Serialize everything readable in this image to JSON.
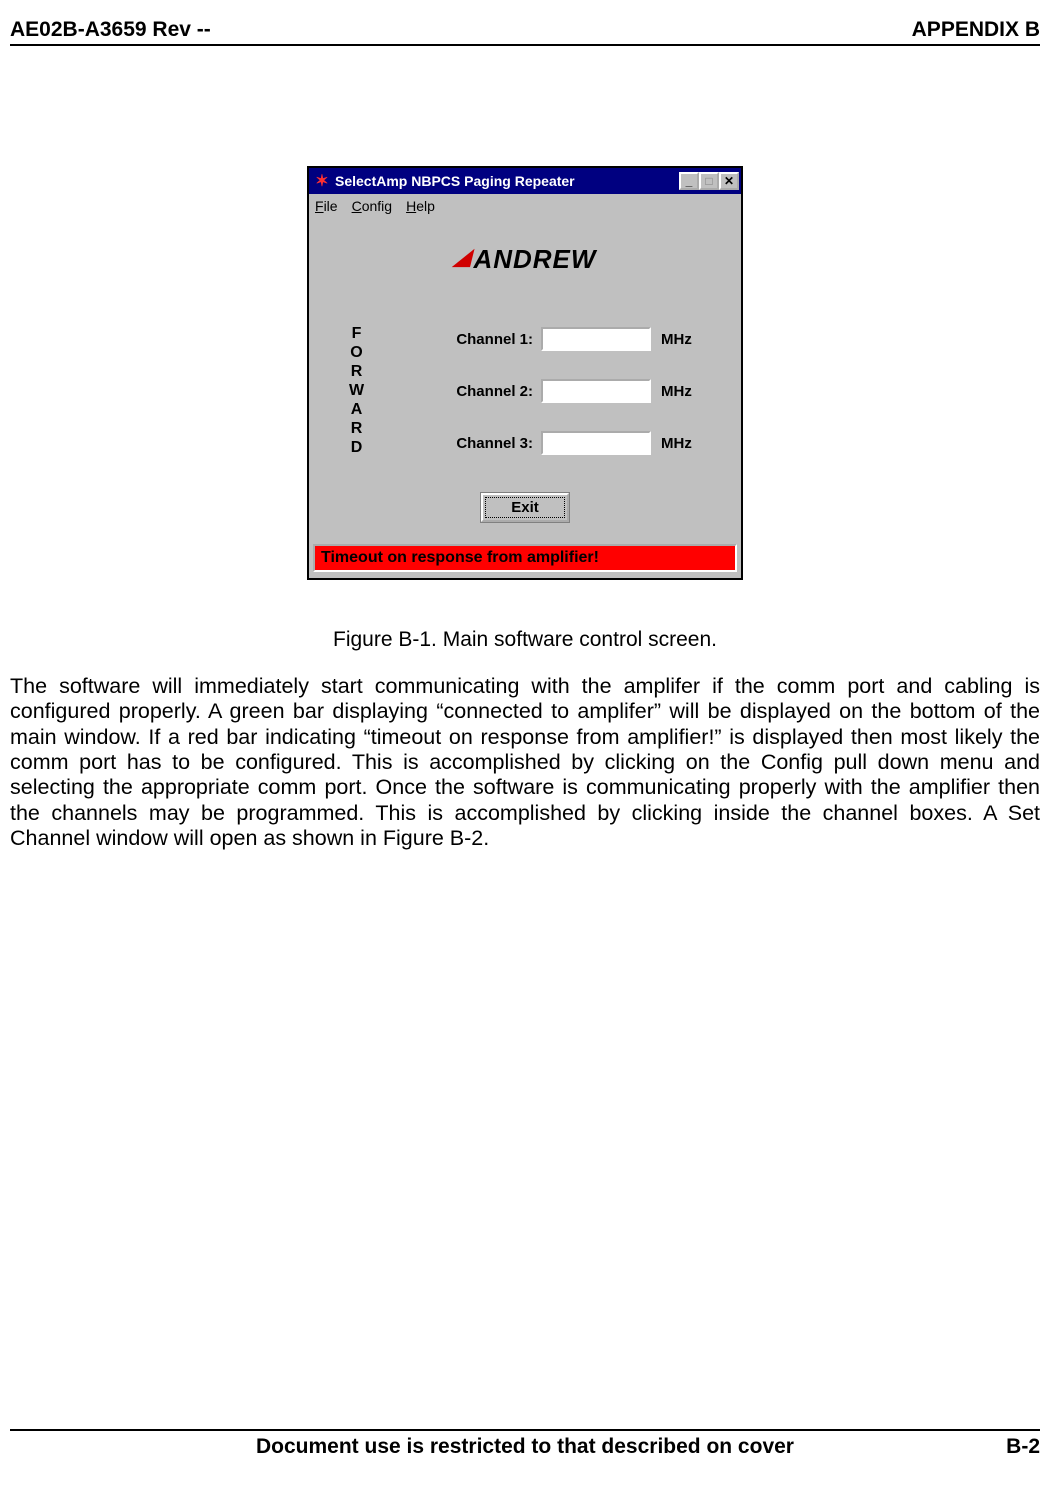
{
  "page_header": {
    "left": "AE02B-A3659 Rev --",
    "right": "APPENDIX B"
  },
  "window": {
    "title": "SelectAmp NBPCS Paging Repeater",
    "menus": {
      "file": "File",
      "config": "Config",
      "help": "Help"
    },
    "logo_text": "ANDREW",
    "group_label": "FORWARD",
    "channels": [
      {
        "label": "Channel 1:",
        "value": "",
        "unit": "MHz"
      },
      {
        "label": "Channel 2:",
        "value": "",
        "unit": "MHz"
      },
      {
        "label": "Channel 3:",
        "value": "",
        "unit": "MHz"
      }
    ],
    "exit_label": "Exit",
    "status_text": "Timeout on response from amplifier!"
  },
  "caption": "Figure B-1.  Main software control screen.",
  "body": "The software will immediately start communicating with the amplifer if the comm port and cabling is configured properly.  A green bar displaying “connected to amplifer” will be displayed on the bottom of the main window.  If a red bar indicating “timeout on response from amplifier!” is displayed then most likely the comm port has to be configured.  This is accomplished by clicking on the Config pull down menu and selecting the appropriate comm port.  Once the software is communicating properly with the amplifier then the channels may be programmed.  This is accomplished by clicking inside the channel boxes.  A Set Channel window will open as shown in Figure B-2.",
  "footer": {
    "text": "Document use is restricted to that described on cover",
    "page": "B-2"
  }
}
